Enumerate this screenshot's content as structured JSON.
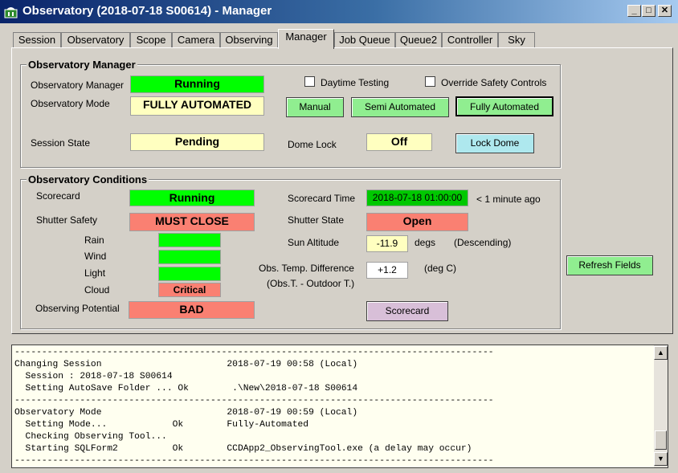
{
  "window": {
    "title": "Observatory (2018-07-18 S00614) - Manager",
    "min": "_",
    "max": "□",
    "close": "✕"
  },
  "tabs": [
    "Session",
    "Observatory",
    "Scope",
    "Camera",
    "Observing",
    "Manager",
    "Job Queue",
    "Queue2",
    "Controller",
    "Sky"
  ],
  "manager": {
    "title": "Observatory Manager",
    "manager_label": "Observatory Manager",
    "manager_value": "Running",
    "mode_label": "Observatory Mode",
    "mode_value": "FULLY AUTOMATED",
    "daytime_testing": "Daytime Testing",
    "override_safety": "Override Safety Controls",
    "btn_manual": "Manual",
    "btn_semi": "Semi Automated",
    "btn_fully": "Fully Automated",
    "session_state_label": "Session State",
    "session_state_value": "Pending",
    "dome_lock_label": "Dome Lock",
    "dome_lock_value": "Off",
    "btn_lock_dome": "Lock Dome"
  },
  "conditions": {
    "title": "Observatory Conditions",
    "scorecard_label": "Scorecard",
    "scorecard_value": "Running",
    "scorecard_time_label": "Scorecard Time",
    "scorecard_time_value": "2018-07-18 01:00:00",
    "scorecard_time_ago": "< 1 minute ago",
    "shutter_safety_label": "Shutter Safety",
    "shutter_safety_value": "MUST CLOSE",
    "shutter_state_label": "Shutter State",
    "shutter_state_value": "Open",
    "rain_label": "Rain",
    "wind_label": "Wind",
    "light_label": "Light",
    "cloud_label": "Cloud",
    "cloud_value": "Critical",
    "sun_alt_label": "Sun Altitude",
    "sun_alt_value": "-11.9",
    "sun_alt_unit": "degs",
    "sun_alt_note": "(Descending)",
    "temp_diff_label": "Obs. Temp. Difference",
    "temp_diff_sub": "(Obs.T. - Outdoor T.)",
    "temp_diff_value": "+1.2",
    "temp_diff_unit": "(deg C)",
    "potential_label": "Observing Potential",
    "potential_value": "BAD",
    "btn_scorecard": "Scorecard"
  },
  "btn_refresh": "Refresh Fields",
  "log": [
    "----------------------------------------------------------------------------------------",
    "Changing Session                       2018-07-19 00:58 (Local)",
    "  Session : 2018-07-18 S00614",
    "  Setting AutoSave Folder ... Ok        .\\New\\2018-07-18 S00614",
    "----------------------------------------------------------------------------------------",
    "Observatory Mode                       2018-07-19 00:59 (Local)",
    "  Setting Mode...            Ok        Fully-Automated",
    "  Checking Observing Tool...",
    "  Starting SQLForm2          Ok        CCDApp2_ObservingTool.exe (a delay may occur)",
    "----------------------------------------------------------------------------------------"
  ],
  "colors": {
    "green": "#00ff00",
    "yellow": "#ffffc0",
    "red": "#fa8072",
    "button_green": "#90ee90",
    "button_cyan": "#aee8ee",
    "button_lilac": "#d8bfd8"
  }
}
